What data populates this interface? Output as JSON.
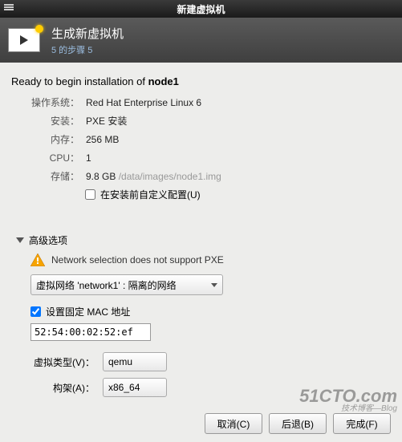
{
  "window": {
    "title": "新建虚拟机"
  },
  "header": {
    "title": "生成新虚拟机",
    "step": "5 的步骤 5"
  },
  "ready": {
    "prefix": "Ready to begin installation of ",
    "name": "node1"
  },
  "spec": {
    "os_label": "操作系统：",
    "os_value": "Red Hat Enterprise Linux 6",
    "install_label": "安装：",
    "install_value": "PXE 安装",
    "mem_label": "内存：",
    "mem_value": "256 MB",
    "cpu_label": "CPU：",
    "cpu_value": "1",
    "storage_label": "存储：",
    "storage_value": "9.8 GB",
    "storage_path": "/data/images/node1.img"
  },
  "customize": {
    "label": "在安装前自定义配置(U)",
    "checked": false
  },
  "advanced": {
    "title": "高级选项",
    "warning": "Network selection does not support PXE",
    "network_select": "虚拟网络 'network1' : 隔离的网络",
    "mac_fixed_label": "设置固定 MAC 地址",
    "mac_fixed_checked": true,
    "mac_value": "52:54:00:02:52:ef",
    "virt_type_label": "虚拟类型(V)：",
    "virt_type_value": "qemu",
    "arch_label": "构架(A)：",
    "arch_value": "x86_64"
  },
  "footer": {
    "cancel": "取消(C)",
    "back": "后退(B)",
    "finish": "完成(F)"
  },
  "watermark": {
    "big": "51CTO.com",
    "small": "技术博客—Blog"
  }
}
